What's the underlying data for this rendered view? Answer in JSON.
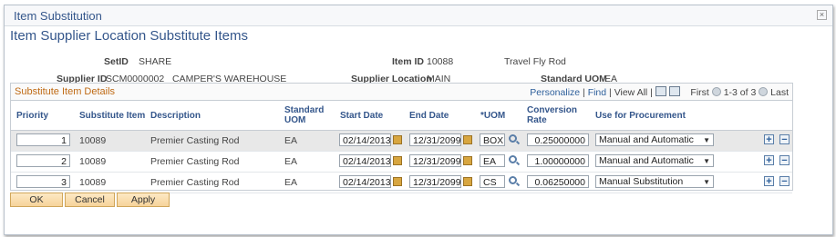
{
  "dialog": {
    "title": "Item Substitution",
    "close_glyph": "×"
  },
  "page": {
    "title": "Item Supplier Location Substitute Items"
  },
  "fields": {
    "setid_label": "SetID",
    "setid_value": "SHARE",
    "itemid_label": "Item ID",
    "itemid_value": "10088",
    "item_desc": "Travel Fly Rod",
    "supplier_label": "Supplier ID",
    "supplier_value": "SCM0000002",
    "supplier_name": "CAMPER'S WAREHOUSE",
    "location_label": "Supplier Location",
    "location_value": "MAIN",
    "uom_label": "Standard UOM",
    "uom_value": "EA"
  },
  "grid": {
    "title": "Substitute Item Details",
    "personalize": "Personalize",
    "find": "Find",
    "view_all": "View All",
    "first": "First",
    "range": "1-3 of 3",
    "last": "Last",
    "columns": [
      "Priority",
      "Substitute Item",
      "Description",
      "Standard UOM",
      "Start Date",
      "End Date",
      "*UOM",
      "Conversion Rate",
      "Use for Procurement"
    ],
    "rows": [
      {
        "priority": "1",
        "item": "10089",
        "desc": "Premier Casting Rod",
        "std_uom": "EA",
        "start": "02/14/2013",
        "end": "12/31/2099",
        "uom": "BOX",
        "rate": "0.25000000",
        "procurement": "Manual and Automatic"
      },
      {
        "priority": "2",
        "item": "10089",
        "desc": "Premier Casting Rod",
        "std_uom": "EA",
        "start": "02/14/2013",
        "end": "12/31/2099",
        "uom": "EA",
        "rate": "1.00000000",
        "procurement": "Manual and Automatic"
      },
      {
        "priority": "3",
        "item": "10089",
        "desc": "Premier Casting Rod",
        "std_uom": "EA",
        "start": "02/14/2013",
        "end": "12/31/2099",
        "uom": "CS",
        "rate": "0.06250000",
        "procurement": "Manual Substitution"
      }
    ],
    "add_glyph": "+",
    "remove_glyph": "−"
  },
  "buttons": {
    "ok": "OK",
    "cancel": "Cancel",
    "apply": "Apply"
  },
  "colors": {
    "title_blue": "#34568b",
    "section_orange": "#bf6a14",
    "button_fill": "#f6d39a"
  }
}
